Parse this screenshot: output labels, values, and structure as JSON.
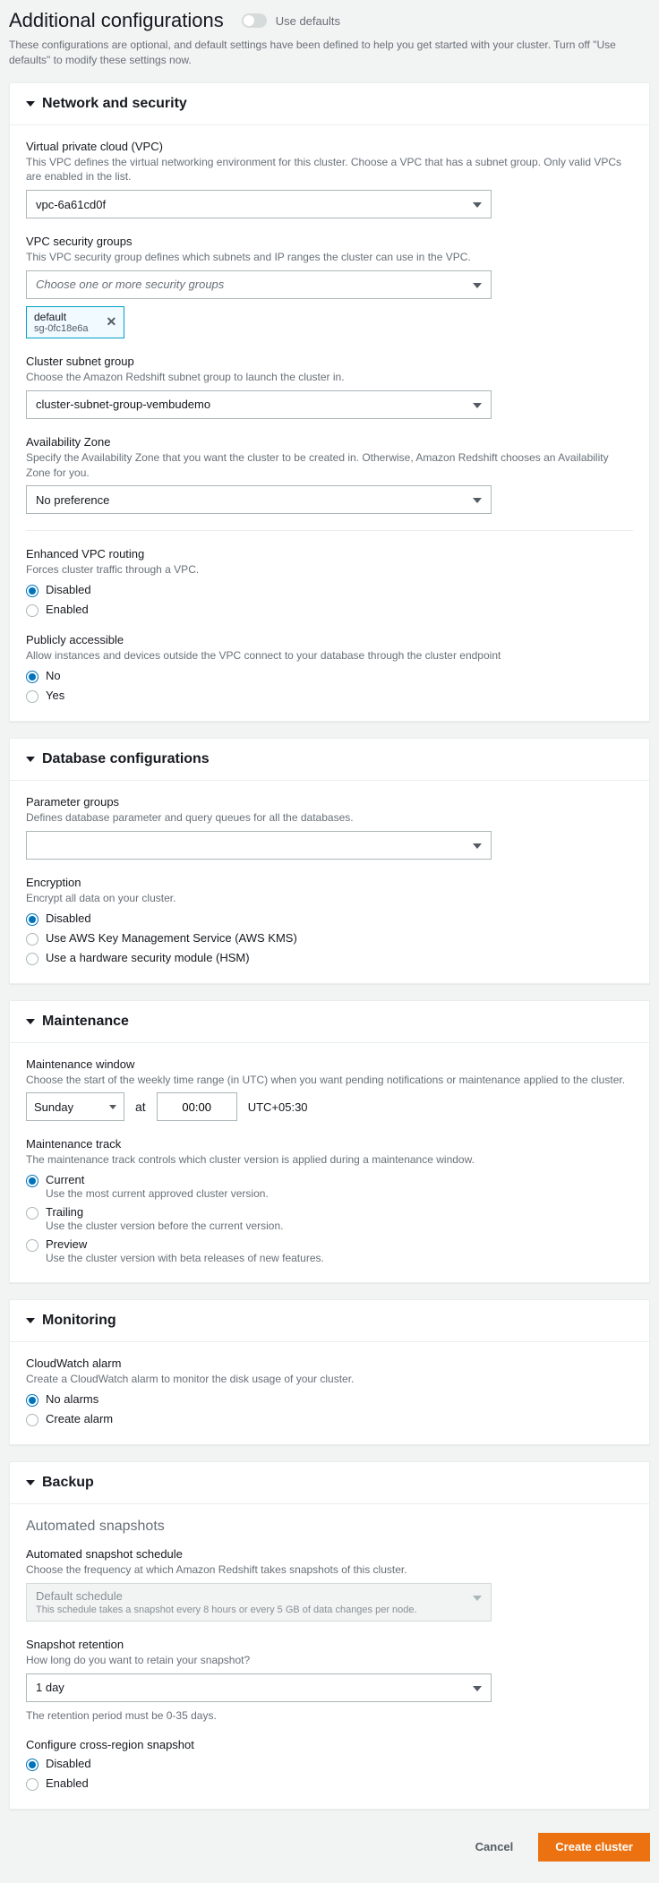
{
  "header": {
    "title": "Additional configurations",
    "toggle_label": "Use defaults",
    "description": "These configurations are optional, and default settings have been defined to help you get started with your cluster. Turn off \"Use defaults\" to modify these settings now."
  },
  "network": {
    "title": "Network and security",
    "vpc": {
      "label": "Virtual private cloud (VPC)",
      "desc": "This VPC defines the virtual networking environment for this cluster. Choose a VPC that has a subnet group. Only valid VPCs are enabled in the list.",
      "value": "vpc-6a61cd0f"
    },
    "sg": {
      "label": "VPC security groups",
      "desc": "This VPC security group defines which subnets and IP ranges the cluster can use in the VPC.",
      "placeholder": "Choose one or more security groups",
      "tag_name": "default",
      "tag_id": "sg-0fc18e6a"
    },
    "subnet": {
      "label": "Cluster subnet group",
      "desc": "Choose the Amazon Redshift subnet group to launch the cluster in.",
      "value": "cluster-subnet-group-vembudemo"
    },
    "az": {
      "label": "Availability Zone",
      "desc": "Specify the Availability Zone that you want the cluster to be created in. Otherwise, Amazon Redshift chooses an Availability Zone for you.",
      "value": "No preference"
    },
    "evr": {
      "label": "Enhanced VPC routing",
      "desc": "Forces cluster traffic through a VPC.",
      "opt_disabled": "Disabled",
      "opt_enabled": "Enabled"
    },
    "public": {
      "label": "Publicly accessible",
      "desc": "Allow instances and devices outside the VPC connect to your database through the cluster endpoint",
      "opt_no": "No",
      "opt_yes": "Yes"
    }
  },
  "database": {
    "title": "Database configurations",
    "pg": {
      "label": "Parameter groups",
      "desc": "Defines database parameter and query queues for all the databases."
    },
    "enc": {
      "label": "Encryption",
      "desc": "Encrypt all data on your cluster.",
      "opt_disabled": "Disabled",
      "opt_kms": "Use AWS Key Management Service (AWS KMS)",
      "opt_hsm": "Use a hardware security module (HSM)"
    }
  },
  "maintenance": {
    "title": "Maintenance",
    "window": {
      "label": "Maintenance window",
      "desc": "Choose the start of the weekly time range (in UTC) when you want pending notifications or maintenance applied to the cluster.",
      "day": "Sunday",
      "at": "at",
      "time": "00:00",
      "tz": "UTC+05:30"
    },
    "track": {
      "label": "Maintenance track",
      "desc": "The maintenance track controls which cluster version is applied during a maintenance window.",
      "current": "Current",
      "current_sub": "Use the most current approved cluster version.",
      "trailing": "Trailing",
      "trailing_sub": "Use the cluster version before the current version.",
      "preview": "Preview",
      "preview_sub": "Use the cluster version with beta releases of new features."
    }
  },
  "monitoring": {
    "title": "Monitoring",
    "cw": {
      "label": "CloudWatch alarm",
      "desc": "Create a CloudWatch alarm to monitor the disk usage of your cluster.",
      "opt_none": "No alarms",
      "opt_create": "Create alarm"
    }
  },
  "backup": {
    "title": "Backup",
    "subtitle": "Automated snapshots",
    "schedule": {
      "label": "Automated snapshot schedule",
      "desc": "Choose the frequency at which Amazon Redshift takes snapshots of this cluster.",
      "value": "Default schedule",
      "sub": "This schedule takes a snapshot every 8 hours or every 5 GB of data changes per node."
    },
    "retention": {
      "label": "Snapshot retention",
      "desc": "How long do you want to retain your snapshot?",
      "value": "1 day",
      "note": "The retention period must be 0-35 days."
    },
    "cross": {
      "label": "Configure cross-region snapshot",
      "opt_disabled": "Disabled",
      "opt_enabled": "Enabled"
    }
  },
  "footer": {
    "cancel": "Cancel",
    "create": "Create cluster"
  }
}
